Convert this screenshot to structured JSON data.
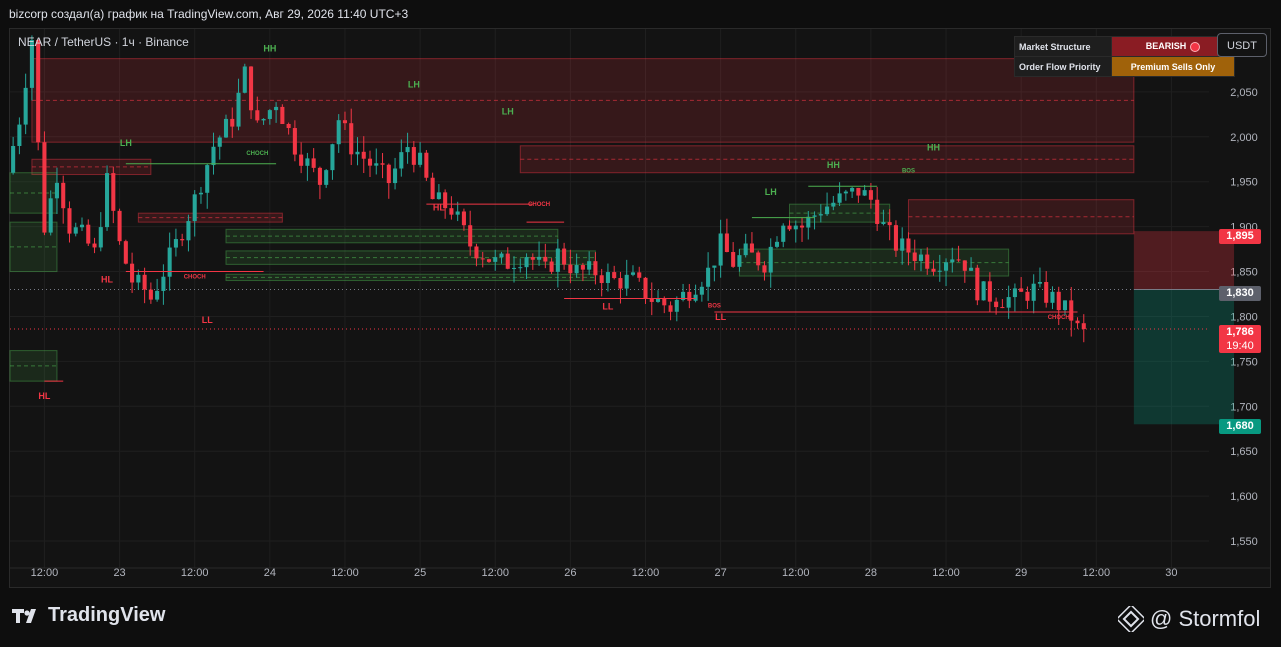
{
  "header": {
    "caption": "bizcorp создал(a) график на TradingView.com, Авг 29, 2026 11:40 UTC+3"
  },
  "symbol_info": "NEAR / TetherUS · 1ч · Binance",
  "currency_button": "USDT",
  "market_table": [
    {
      "key": "Market Structure",
      "value": "BEARISH"
    },
    {
      "key": "Order Flow Priority",
      "value": "Premium Sells Only"
    }
  ],
  "colors": {
    "bull": "#26a69a",
    "bear": "#f23645",
    "smc_green": "#4caf50",
    "premium_orange": "#a0620a",
    "target_green": "#089981"
  },
  "price_tags": [
    {
      "value": "1,895",
      "color": "#f23645"
    },
    {
      "value": "1,830",
      "color": "#5d606b"
    },
    {
      "value": "1,786",
      "countdown": "19:40",
      "color": "#f23645"
    },
    {
      "value": "1,680",
      "color": "#089981"
    }
  ],
  "chart_data": {
    "type": "candlestick",
    "symbol": "NEAR / TetherUS",
    "interval": "1ч",
    "exchange": "Binance",
    "y_ticks": [
      "2,050",
      "2,000",
      "1,950",
      "1,900",
      "1,850",
      "1,800",
      "1,750",
      "1,700",
      "1,650",
      "1,600",
      "1,550"
    ],
    "y_tick_values": [
      2.05,
      2.0,
      1.95,
      1.9,
      1.85,
      1.8,
      1.75,
      1.7,
      1.65,
      1.6,
      1.55
    ],
    "ylim": [
      1.52,
      2.12
    ],
    "x_ticks": [
      {
        "label": "12:00",
        "t": 5
      },
      {
        "label": "23",
        "t": 17
      },
      {
        "label": "12:00",
        "t": 29
      },
      {
        "label": "24",
        "t": 41
      },
      {
        "label": "12:00",
        "t": 53
      },
      {
        "label": "25",
        "t": 65
      },
      {
        "label": "12:00",
        "t": 77
      },
      {
        "label": "26",
        "t": 89
      },
      {
        "label": "12:00",
        "t": 101
      },
      {
        "label": "27",
        "t": 113
      },
      {
        "label": "12:00",
        "t": 125
      },
      {
        "label": "28",
        "t": 137
      },
      {
        "label": "12:00",
        "t": 149
      },
      {
        "label": "29",
        "t": 161
      },
      {
        "label": "12:00",
        "t": 173
      },
      {
        "label": "30",
        "t": 185
      }
    ],
    "t_range": [
      -0.5,
      191
    ],
    "anchors": [
      [
        0,
        1.96
      ],
      [
        2,
        2.02
      ],
      [
        4,
        2.11
      ],
      [
        5,
        1.99
      ],
      [
        6,
        1.9
      ],
      [
        8,
        1.96
      ],
      [
        10,
        1.9
      ],
      [
        12,
        1.89
      ],
      [
        14,
        1.87
      ],
      [
        16,
        1.95
      ],
      [
        18,
        1.88
      ],
      [
        20,
        1.84
      ],
      [
        22,
        1.83
      ],
      [
        23,
        1.82
      ],
      [
        25,
        1.85
      ],
      [
        27,
        1.88
      ],
      [
        30,
        1.93
      ],
      [
        33,
        1.99
      ],
      [
        36,
        2.02
      ],
      [
        38,
        2.07
      ],
      [
        40,
        2.01
      ],
      [
        43,
        2.04
      ],
      [
        46,
        1.99
      ],
      [
        50,
        1.95
      ],
      [
        53,
        2.02
      ],
      [
        55,
        1.99
      ],
      [
        58,
        1.97
      ],
      [
        61,
        1.95
      ],
      [
        64,
        1.99
      ],
      [
        66,
        1.97
      ],
      [
        68,
        1.93
      ],
      [
        71,
        1.92
      ],
      [
        74,
        1.88
      ],
      [
        76,
        1.87
      ],
      [
        78,
        1.86
      ],
      [
        80,
        1.86
      ],
      [
        83,
        1.87
      ],
      [
        86,
        1.85
      ],
      [
        88,
        1.87
      ],
      [
        91,
        1.85
      ],
      [
        94,
        1.85
      ],
      [
        97,
        1.84
      ],
      [
        100,
        1.84
      ],
      [
        103,
        1.82
      ],
      [
        106,
        1.81
      ],
      [
        109,
        1.83
      ],
      [
        112,
        1.85
      ],
      [
        114,
        1.88
      ],
      [
        116,
        1.86
      ],
      [
        118,
        1.87
      ],
      [
        121,
        1.86
      ],
      [
        124,
        1.91
      ],
      [
        127,
        1.9
      ],
      [
        130,
        1.92
      ],
      [
        133,
        1.93
      ],
      [
        136,
        1.94
      ],
      [
        138,
        1.93
      ],
      [
        140,
        1.9
      ],
      [
        142,
        1.88
      ],
      [
        145,
        1.87
      ],
      [
        148,
        1.86
      ],
      [
        151,
        1.87
      ],
      [
        153,
        1.86
      ],
      [
        155,
        1.83
      ],
      [
        158,
        1.82
      ],
      [
        161,
        1.82
      ],
      [
        164,
        1.83
      ],
      [
        167,
        1.82
      ],
      [
        170,
        1.8
      ],
      [
        171,
        1.786
      ]
    ],
    "zones": [
      {
        "type": "supply",
        "t0": 3,
        "t1": 179,
        "y0": 2.087,
        "y1": 1.994
      },
      {
        "type": "supply",
        "t0": 81,
        "t1": 179,
        "y0": 1.99,
        "y1": 1.96
      },
      {
        "type": "supply",
        "t0": 3,
        "t1": 22,
        "y0": 1.975,
        "y1": 1.958
      },
      {
        "type": "supply",
        "t0": 143,
        "t1": 179,
        "y0": 1.93,
        "y1": 1.892
      },
      {
        "type": "supply",
        "t0": 20,
        "t1": 43,
        "y0": 1.915,
        "y1": 1.905
      },
      {
        "type": "demand",
        "t0": -0.5,
        "t1": 7,
        "y0": 1.96,
        "y1": 1.915
      },
      {
        "type": "demand",
        "t0": -0.5,
        "t1": 7,
        "y0": 1.905,
        "y1": 1.85
      },
      {
        "type": "demand",
        "t0": -0.5,
        "t1": 7,
        "y0": 1.762,
        "y1": 1.728
      },
      {
        "type": "demand",
        "t0": 34,
        "t1": 87,
        "y0": 1.897,
        "y1": 1.882
      },
      {
        "type": "demand",
        "t0": 34,
        "t1": 93,
        "y0": 1.873,
        "y1": 1.858
      },
      {
        "type": "demand",
        "t0": 34,
        "t1": 93,
        "y0": 1.847,
        "y1": 1.84
      },
      {
        "type": "demand",
        "t0": 116,
        "t1": 159,
        "y0": 1.875,
        "y1": 1.845
      },
      {
        "type": "demand",
        "t0": 124,
        "t1": 140,
        "y0": 1.925,
        "y1": 1.905
      }
    ],
    "structure_lines": [
      {
        "t0": 18,
        "t1": 42,
        "y": 1.97,
        "color": "green"
      },
      {
        "t0": 18,
        "t1": 40,
        "y": 1.85,
        "color": "red"
      },
      {
        "t0": 66,
        "t1": 83,
        "y": 1.925,
        "color": "red"
      },
      {
        "t0": 82,
        "t1": 88,
        "y": 1.905,
        "color": "red"
      },
      {
        "t0": 88,
        "t1": 109,
        "y": 1.82,
        "color": "red"
      },
      {
        "t0": 112,
        "t1": 170,
        "y": 1.805,
        "color": "red"
      },
      {
        "t0": 118,
        "t1": 128,
        "y": 1.91,
        "color": "green"
      },
      {
        "t0": 127,
        "t1": 138,
        "y": 1.945,
        "color": "green"
      },
      {
        "t0": 5,
        "t1": 8,
        "y": 1.728,
        "color": "red"
      }
    ],
    "labels": [
      {
        "text": "HH",
        "t": 41,
        "y": 2.095,
        "color": "green"
      },
      {
        "text": "LH",
        "t": 18,
        "y": 1.99,
        "color": "green"
      },
      {
        "text": "LH",
        "t": 64,
        "y": 2.055,
        "color": "green"
      },
      {
        "text": "LH",
        "t": 79,
        "y": 2.025,
        "color": "green"
      },
      {
        "text": "LH",
        "t": 121,
        "y": 1.935,
        "color": "green"
      },
      {
        "text": "HH",
        "t": 131,
        "y": 1.965,
        "color": "green"
      },
      {
        "text": "HH",
        "t": 147,
        "y": 1.985,
        "color": "green"
      },
      {
        "text": "HL",
        "t": 15,
        "y": 1.838,
        "color": "red"
      },
      {
        "text": "HL",
        "t": 68,
        "y": 1.918,
        "color": "red"
      },
      {
        "text": "HL",
        "t": 5,
        "y": 1.708,
        "color": "red"
      },
      {
        "text": "LL",
        "t": 31,
        "y": 1.793,
        "color": "red"
      },
      {
        "text": "LL",
        "t": 95,
        "y": 1.808,
        "color": "red"
      },
      {
        "text": "LL",
        "t": 113,
        "y": 1.796,
        "color": "red"
      },
      {
        "text": "CHOCH",
        "t": 39,
        "y": 1.98,
        "color": "green",
        "small": true
      },
      {
        "text": "CHOCH",
        "t": 29,
        "y": 1.842,
        "color": "red",
        "small": true
      },
      {
        "text": "CHOCH",
        "t": 84,
        "y": 1.923,
        "color": "red",
        "small": true
      },
      {
        "text": "CHOCH",
        "t": 167,
        "y": 1.797,
        "color": "red",
        "small": true
      },
      {
        "text": "BOS",
        "t": 143,
        "y": 1.96,
        "color": "green",
        "small": true
      },
      {
        "text": "BOS",
        "t": 112,
        "y": 1.81,
        "color": "red",
        "small": true
      }
    ],
    "position": {
      "t0": 179,
      "t1": 195,
      "entry": 1.83,
      "stop": 1.895,
      "target": 1.68
    },
    "current_price": 1.786
  },
  "branding": {
    "logo_text": "TradingView",
    "author": "@ Stormfol"
  }
}
